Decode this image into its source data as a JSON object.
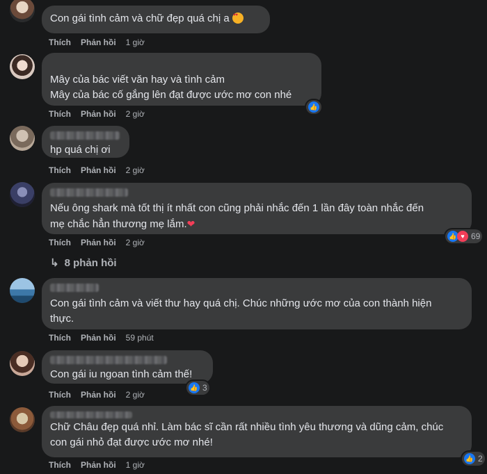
{
  "comments": [
    {
      "text": "Con gái tình cảm và chữ đẹp quá chị a",
      "like": "Thích",
      "reply": "Phản hồi",
      "time": "1 giờ",
      "emoji": "heart-eyes-emoji"
    },
    {
      "text": "Mây của bác viết văn hay và tình cảm\nMây của bác cố gắng lên đạt được ước mơ con nhé",
      "like": "Thích",
      "reply": "Phản hồi",
      "time": "2 giờ"
    },
    {
      "text": "hp quá chị ơi",
      "like": "Thích",
      "reply": "Phản hồi",
      "time": "2 giờ"
    },
    {
      "text": "Nếu ông shark mà tốt thị ít nhất con cũng phải nhắc đến 1 lần đây toàn nhắc đến\nmẹ chắc hẳn thương mẹ lắm.",
      "like": "Thích",
      "reply": "Phản hồi",
      "time": "2 giờ",
      "reaction_count": "69",
      "heart_glyph": "❤"
    },
    {
      "text": "Con gái tình cảm và viết thư hay quá chị. Chúc những ước mơ của con thành hiện\nthực.",
      "like": "Thích",
      "reply": "Phản hồi",
      "time": "59 phút"
    },
    {
      "text": "Con gái iu ngoan tình cảm thế!",
      "like": "Thích",
      "reply": "Phản hồi",
      "time": "2 giờ",
      "reaction_count": "3"
    },
    {
      "text": "Chữ Châu đẹp quá nhỉ. Làm bác sĩ cần rất nhiều tình yêu thương và dũng cảm, chúc\ncon gái nhỏ đạt được ước mơ nhé!",
      "like": "Thích",
      "reply": "Phản hồi",
      "time": "1 giờ",
      "reaction_count": "2"
    }
  ],
  "view_replies": "8 phản hồi",
  "reply_arrow": "↳",
  "icons": {
    "like": "👍",
    "heart": "♥"
  },
  "colors": {
    "like": "#1877f2",
    "heart": "#f33e58"
  }
}
